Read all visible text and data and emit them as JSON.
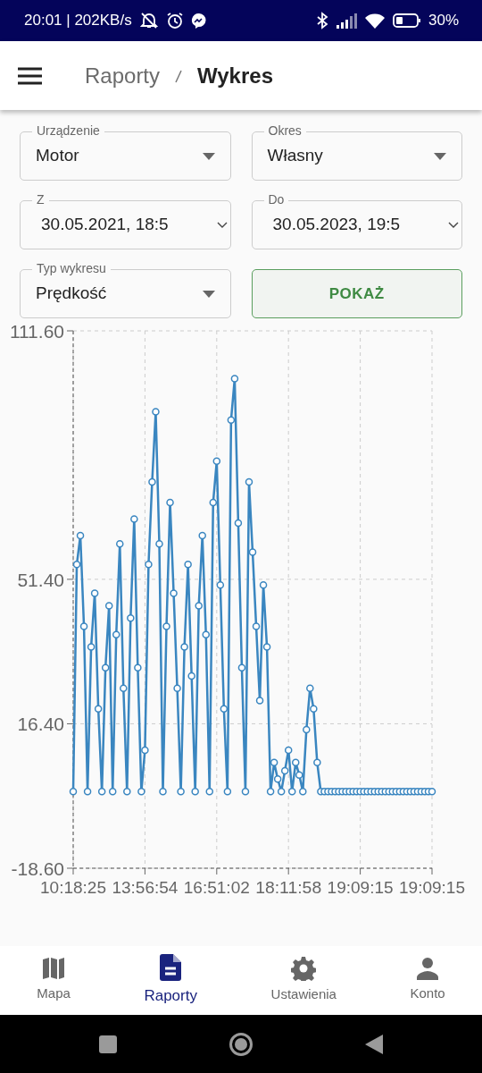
{
  "status_bar": {
    "time": "20:01 | 202KB/s",
    "battery": "30%"
  },
  "app_bar": {
    "breadcrumb": [
      {
        "label": "Raporty",
        "selected": false
      },
      {
        "label": "Wykres",
        "selected": true
      }
    ]
  },
  "form": {
    "fields": [
      {
        "kind": "select",
        "label": "Urządzenie",
        "value": "Motor"
      },
      {
        "kind": "select",
        "label": "Okres",
        "value": "Własny"
      },
      {
        "kind": "date",
        "label": "Z",
        "value": "30.05.2021, 18:5"
      },
      {
        "kind": "date",
        "label": "Do",
        "value": "30.05.2023, 19:5"
      },
      {
        "kind": "select",
        "label": "Typ wykresu",
        "value": "Prędkość"
      },
      {
        "kind": "button",
        "label": "POKAŻ"
      }
    ]
  },
  "chart": {
    "chart_data": {
      "type": "line",
      "categories": [
        "10:18:25",
        null,
        null,
        null,
        null,
        null,
        null,
        null,
        null,
        null,
        null,
        null,
        null,
        null,
        null,
        null,
        null,
        null,
        null,
        null,
        "13:56:54",
        null,
        null,
        null,
        null,
        null,
        null,
        null,
        null,
        null,
        null,
        null,
        null,
        null,
        null,
        null,
        null,
        null,
        null,
        null,
        "16:51:02",
        null,
        null,
        null,
        null,
        null,
        null,
        null,
        null,
        null,
        null,
        null,
        null,
        null,
        null,
        null,
        null,
        null,
        null,
        null,
        "18:11:58",
        null,
        null,
        null,
        null,
        null,
        null,
        null,
        null,
        null,
        null,
        null,
        null,
        null,
        null,
        null,
        null,
        null,
        null,
        null,
        "19:09:15",
        null,
        null,
        null,
        null,
        null,
        null,
        null,
        null,
        null,
        null,
        null,
        null,
        null,
        null,
        null,
        null,
        null,
        null,
        null,
        "19:09:15"
      ],
      "grid": true,
      "series": [
        {
          "color": "#3a86c0",
          "marker": "circle",
          "values": [
            0,
            55,
            62,
            40,
            0,
            35,
            48,
            20,
            0,
            30,
            45,
            0,
            38,
            60,
            25,
            0,
            42,
            66,
            30,
            0,
            10,
            55,
            75,
            92,
            60,
            0,
            40,
            70,
            48,
            25,
            0,
            35,
            55,
            28,
            0,
            45,
            62,
            38,
            0,
            70,
            80,
            50,
            20,
            0,
            90,
            100,
            65,
            30,
            0,
            75,
            58,
            40,
            22,
            50,
            35,
            0,
            7,
            3,
            0,
            5,
            10,
            0,
            7,
            4,
            0,
            15,
            25,
            20,
            7,
            0,
            0,
            0,
            0,
            0,
            0,
            0,
            0,
            0,
            0,
            0,
            0,
            0,
            0,
            0,
            0,
            0,
            0,
            0,
            0,
            0,
            0,
            0,
            0,
            0,
            0,
            0,
            0,
            0,
            0,
            0,
            0
          ]
        }
      ],
      "ylim": [
        -18.6,
        111.6
      ],
      "yticks": [
        {
          "value": 111.6,
          "label": "111.60"
        },
        {
          "value": 51.4,
          "label": "51.40"
        },
        {
          "value": 16.4,
          "label": "16.40"
        },
        {
          "value": -18.6,
          "label": "-18.60"
        }
      ]
    }
  },
  "bottom_nav": [
    {
      "label": "Mapa",
      "selected": false
    },
    {
      "label": "Raporty",
      "selected": true
    },
    {
      "label": "Ustawienia",
      "selected": false
    },
    {
      "label": "Konto",
      "selected": false
    }
  ]
}
